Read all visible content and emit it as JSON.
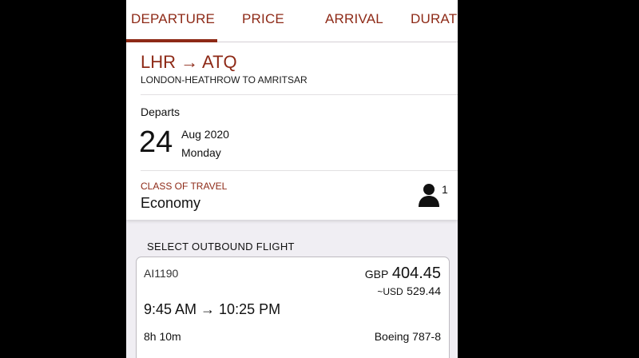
{
  "tabs": [
    {
      "label": "DEPARTURE",
      "active": true
    },
    {
      "label": "PRICE",
      "active": false
    },
    {
      "label": "ARRIVAL",
      "active": false
    },
    {
      "label": "DURAT",
      "active": false
    }
  ],
  "colors": {
    "accent": "#8e2a17",
    "background": "#f0eef3",
    "card": "#ffffff"
  },
  "route": {
    "codes": "LHR → ATQ",
    "name": "LONDON-HEATHROW TO AMRITSAR"
  },
  "departs": {
    "label": "Departs",
    "day": "24",
    "month_year": "Aug 2020",
    "weekday": "Monday"
  },
  "class_of_travel": {
    "label": "CLASS OF TRAVEL",
    "value": "Economy",
    "passenger_icon": "person-icon",
    "passenger_count": "1"
  },
  "section_label": "SELECT OUTBOUND FLIGHT",
  "flight": {
    "number": "AI1190",
    "price_currency": "GBP",
    "price_amount": "404.45",
    "alt_price_currency": "~USD",
    "alt_price_amount": "529.44",
    "times": "9:45 AM → 10:25 PM",
    "duration": "8h 10m",
    "aircraft": "Boeing 787-8"
  }
}
